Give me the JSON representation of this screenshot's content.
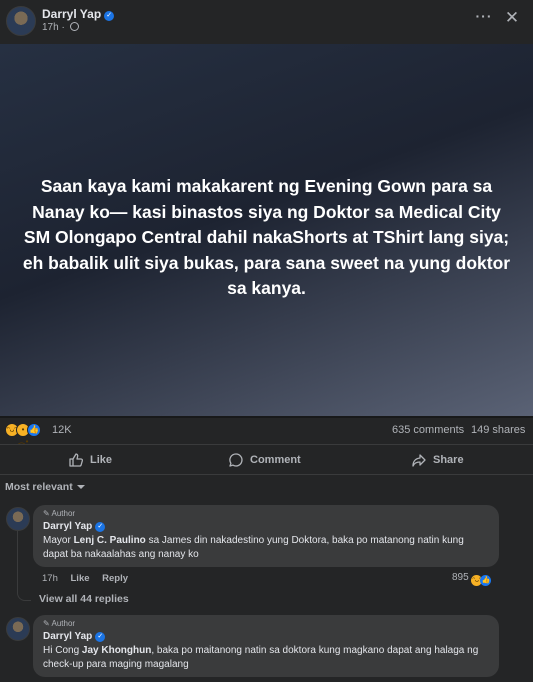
{
  "post": {
    "author": "Darryl Yap",
    "time": "17h ·",
    "text": "Saan kaya kami makakarent ng Evening Gown para sa Nanay ko— kasi binastos siya ng Doktor sa Medical City SM Olongapo Central dahil nakaShorts at TShirt lang siya; eh babalik ulit siya bukas, para sana sweet na yung doktor sa kanya.",
    "reaction_count": "12K",
    "comments_count": "635 comments",
    "shares_count": "149 shares"
  },
  "actions": {
    "like": "Like",
    "comment": "Comment",
    "share": "Share"
  },
  "sort": "Most relevant",
  "comments": [
    {
      "badge": "Author",
      "name": "Darryl Yap",
      "text_before": "Mayor ",
      "mention": "Lenj C. Paulino",
      "text_after": " sa James din nakadestino yung Doktora, baka po matanong natin kung dapat ba nakaalahas ang nanay ko",
      "time": "17h",
      "like": "Like",
      "reply": "Reply",
      "reactions": "895"
    },
    {
      "badge": "Author",
      "name": "Darryl Yap",
      "text_before": "Hi Cong ",
      "mention": "Jay Khonghun",
      "text_after": ", baka po maitanong natin sa doktora kung magkano dapat ang halaga ng check-up para maging magalang"
    }
  ],
  "view_replies": "View all 44 replies"
}
